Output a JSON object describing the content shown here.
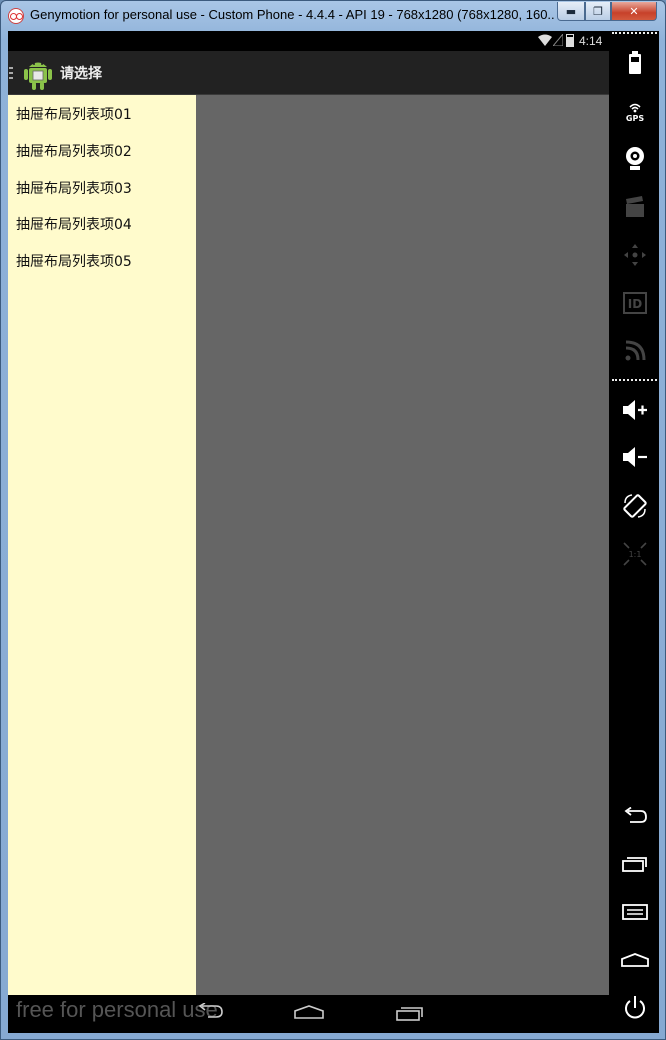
{
  "window": {
    "title": "Genymotion for personal use - Custom Phone - 4.4.4 - API 19 - 768x1280 (768x1280, 160..."
  },
  "statusbar": {
    "time": "4:14"
  },
  "actionbar": {
    "title": "请选择"
  },
  "drawer": {
    "items": [
      {
        "label": "抽屉布局列表项01"
      },
      {
        "label": "抽屉布局列表项02"
      },
      {
        "label": "抽屉布局列表项03"
      },
      {
        "label": "抽屉布局列表项04"
      },
      {
        "label": "抽屉布局列表项05"
      }
    ]
  },
  "navbar": {
    "watermark": "free for personal use"
  },
  "toolbar": {
    "gps_label": "GPS",
    "id_label": "ID",
    "pixel_label": "1:1"
  },
  "colors": {
    "drawer_bg": "#fffbcc",
    "content_bg": "#666666",
    "actionbar_bg": "#222222"
  }
}
